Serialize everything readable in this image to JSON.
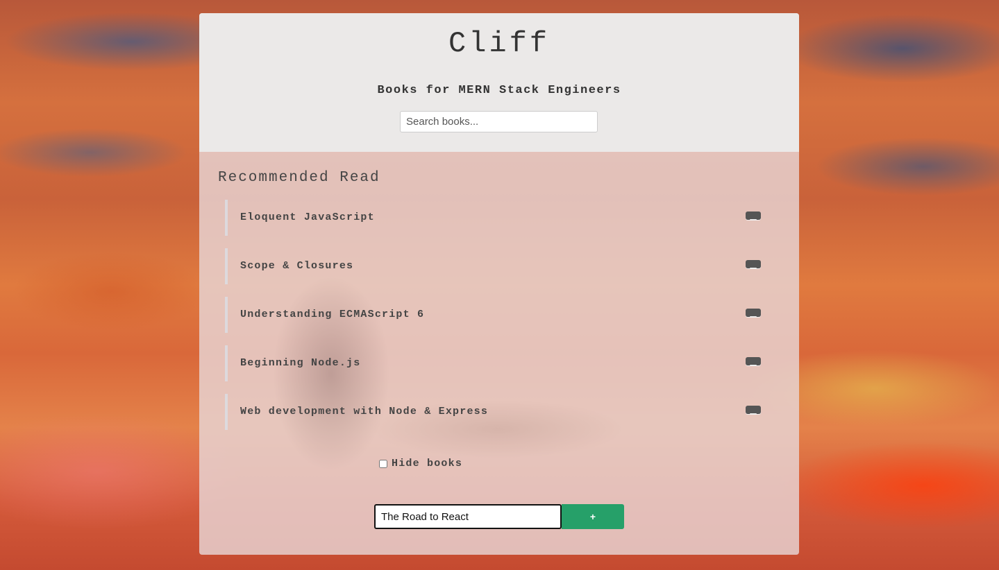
{
  "header": {
    "logo": "Cliff",
    "subtitle": "Books for MERN Stack Engineers",
    "search_placeholder": "Search books..."
  },
  "main": {
    "section_title": "Recommended Read",
    "books": [
      {
        "name": "Eloquent JavaScript"
      },
      {
        "name": "Scope & Closures"
      },
      {
        "name": "Understanding ECMAScript 6"
      },
      {
        "name": "Beginning Node.js"
      },
      {
        "name": "Web development with Node & Express"
      }
    ],
    "hide_label": "Hide books",
    "hide_checked": false
  },
  "add_form": {
    "input_value": "The Road to React",
    "button_label": "+"
  },
  "colors": {
    "accent": "#26a069",
    "header_bg": "#ebe9e8",
    "text": "#444444"
  }
}
